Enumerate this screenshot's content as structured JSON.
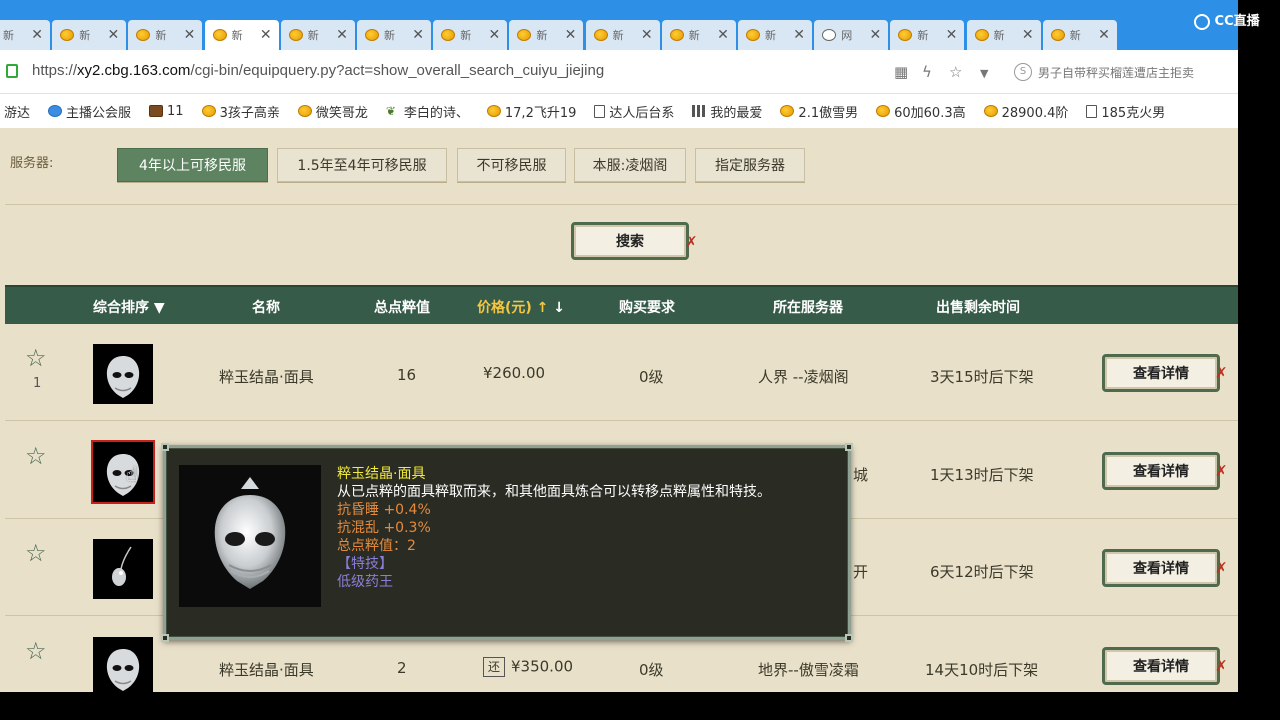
{
  "tabs": [
    {
      "label": "新",
      "icon": "game-icon",
      "active": false
    },
    {
      "label": "新",
      "icon": "game-icon",
      "active": false
    },
    {
      "label": "新",
      "icon": "game-icon",
      "active": false
    },
    {
      "label": "新",
      "icon": "game-icon",
      "active": true
    },
    {
      "label": "新",
      "icon": "game-icon",
      "active": false
    },
    {
      "label": "新",
      "icon": "game-icon",
      "active": false
    },
    {
      "label": "新",
      "icon": "game-icon",
      "active": false
    },
    {
      "label": "新",
      "icon": "game-icon",
      "active": false
    },
    {
      "label": "新",
      "icon": "game-icon",
      "active": false
    },
    {
      "label": "新",
      "icon": "game-icon",
      "active": false
    },
    {
      "label": "新",
      "icon": "game-icon",
      "active": false
    },
    {
      "label": "网",
      "icon": "globe-icon",
      "active": false
    },
    {
      "label": "新",
      "icon": "game-icon",
      "active": false
    },
    {
      "label": "新",
      "icon": "game-icon",
      "active": false
    },
    {
      "label": "新",
      "icon": "game-icon",
      "active": false
    }
  ],
  "watermark": "CC直播",
  "address": {
    "scheme": "https://",
    "domain": "xy2.cbg.163.com",
    "path": "/cgi-bin/equipquery.py?act=show_overall_search_cuiyu_jiejing",
    "suggestion": "男子自带秤买榴莲遭店主拒卖"
  },
  "bookmarks": [
    {
      "label": "游达",
      "icon": "none"
    },
    {
      "label": "主播公会服",
      "icon": "blue"
    },
    {
      "label": "11",
      "icon": "brown"
    },
    {
      "label": "3孩子高亲",
      "icon": "game"
    },
    {
      "label": "微笑哥龙",
      "icon": "game"
    },
    {
      "label": "李白的诗、",
      "icon": "plant"
    },
    {
      "label": "17,2飞升19",
      "icon": "game"
    },
    {
      "label": "达人后台系",
      "icon": "page"
    },
    {
      "label": "我的最爱",
      "icon": "grid"
    },
    {
      "label": "2.1傲雪男",
      "icon": "game"
    },
    {
      "label": "60加60.3高",
      "icon": "game"
    },
    {
      "label": "28900.4阶",
      "icon": "game"
    },
    {
      "label": "185克火男",
      "icon": "page"
    }
  ],
  "filters": {
    "label": "服务器:",
    "buttons": [
      "4年以上可移民服",
      "1.5年至4年可移民服",
      "不可移民服",
      "本服:凌烟阁",
      "指定服务器"
    ],
    "active_index": 0
  },
  "search_label": "搜索",
  "table": {
    "headers": {
      "sort": "综合排序",
      "name": "名称",
      "value": "总点粹值",
      "price": "价格(元)",
      "req": "购买要求",
      "server": "所在服务器",
      "time": "出售剩余时间"
    },
    "rows": [
      {
        "rank": "1",
        "name": "粹玉结晶·面具",
        "value": "16",
        "price": "¥260.00",
        "req": "0级",
        "server": "人界 --凌烟阁",
        "time": "3天15时后下架",
        "huan": ""
      },
      {
        "rank": "",
        "name": "",
        "value": "",
        "price": "",
        "req": "",
        "server": "城",
        "time": "1天13时后下架",
        "huan": ""
      },
      {
        "rank": "",
        "name": "",
        "value": "",
        "price": "",
        "req": "",
        "server": "开",
        "time": "6天12时后下架",
        "huan": ""
      },
      {
        "rank": "",
        "name": "粹玉结晶·面具",
        "value": "2",
        "price": "¥350.00",
        "req": "0级",
        "server": "地界--傲雪凌霜",
        "time": "14天10时后下架",
        "huan": "还"
      }
    ],
    "detail_label": "查看详情"
  },
  "tooltip": {
    "name": "粹玉结晶·面具",
    "desc": "从已点粹的面具粹取而来，和其他面具炼合可以转移点粹属性和特技。",
    "props": [
      "抗昏睡 +0.4%",
      "抗混乱 +0.3%",
      "总点粹值：2"
    ],
    "tag": "【特技】",
    "skill": "低级药王"
  },
  "colors": {
    "tab_bar": "#2d90e6",
    "page_bg": "#e9e0c9",
    "header_bg": "#375b49",
    "active_filter": "#5d8361",
    "price_header": "#f3c643"
  }
}
